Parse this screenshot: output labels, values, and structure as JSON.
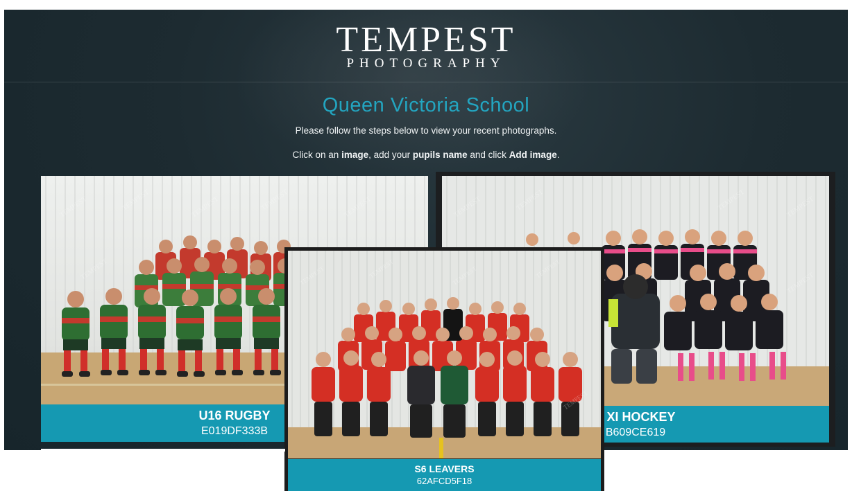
{
  "brand": {
    "name": "TEMPEST",
    "subtitle": "PHOTOGRAPHY"
  },
  "school": {
    "title": "Queen Victoria School"
  },
  "instructions": {
    "line1": "Please follow the steps below to view your recent photographs.",
    "line2_part1": "Click on an ",
    "line2_bold1": "image",
    "line2_part2": ", add your ",
    "line2_bold2": "pupils name",
    "line2_part3": " and click ",
    "line2_bold3": "Add image",
    "line2_part4": "."
  },
  "gallery": {
    "items": [
      {
        "name": "U16 RUGBY",
        "code": "E019DF333B"
      },
      {
        "name": "T XI HOCKEY",
        "code": "B609CE619"
      },
      {
        "name": "S6 LEAVERS",
        "code": "62AFCD5F18"
      }
    ]
  },
  "colors": {
    "accent": "#1599b2",
    "title": "#23a5c0",
    "background": "#1d2b31"
  }
}
